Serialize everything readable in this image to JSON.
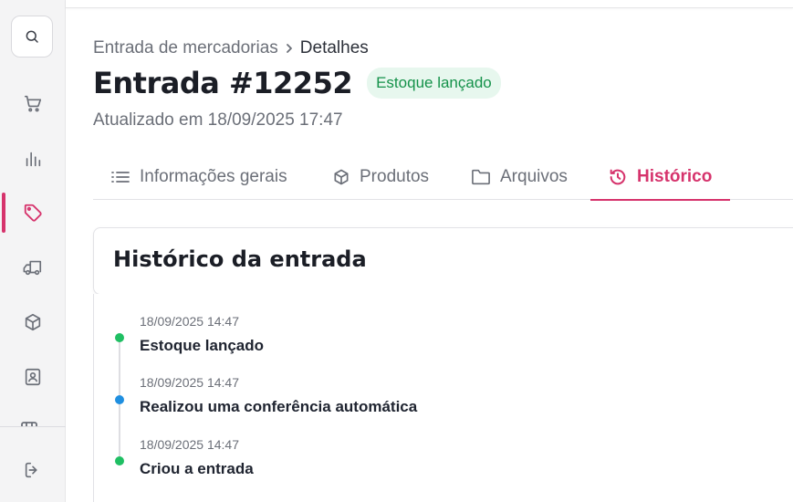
{
  "breadcrumb": {
    "parent": "Entrada de mercadorias",
    "current": "Detalhes"
  },
  "header": {
    "title": "Entrada #12252",
    "status_badge": "Estoque lançado",
    "updated": "Atualizado em 18/09/2025 17:47"
  },
  "tabs": [
    {
      "label": "Informações gerais",
      "icon": "list-icon",
      "active": false
    },
    {
      "label": "Produtos",
      "icon": "box-icon",
      "active": false
    },
    {
      "label": "Arquivos",
      "icon": "folder-icon",
      "active": false
    },
    {
      "label": "Histórico",
      "icon": "history-icon",
      "active": true
    }
  ],
  "history": {
    "title": "Histórico da entrada",
    "events": [
      {
        "date": "18/09/2025 14:47",
        "title": "Estoque lançado",
        "color": "#1fbf63"
      },
      {
        "date": "18/09/2025 14:47",
        "title": "Realizou uma conferência automática",
        "color": "#1f8fe0"
      },
      {
        "date": "18/09/2025 14:47",
        "title": "Criou a entrada",
        "color": "#1fbf63"
      }
    ]
  },
  "sidebar": {
    "items": [
      {
        "icon": "cart-icon",
        "active": false
      },
      {
        "icon": "bar-chart-icon",
        "active": false
      },
      {
        "icon": "tag-icon",
        "active": true
      },
      {
        "icon": "truck-icon",
        "active": false
      },
      {
        "icon": "box-icon",
        "active": false
      },
      {
        "icon": "contact-card-icon",
        "active": false
      }
    ],
    "logout_icon": "logout-icon"
  },
  "colors": {
    "accent": "#d6336c",
    "success_bg": "#e7f7ee",
    "success_text": "#15924a"
  }
}
